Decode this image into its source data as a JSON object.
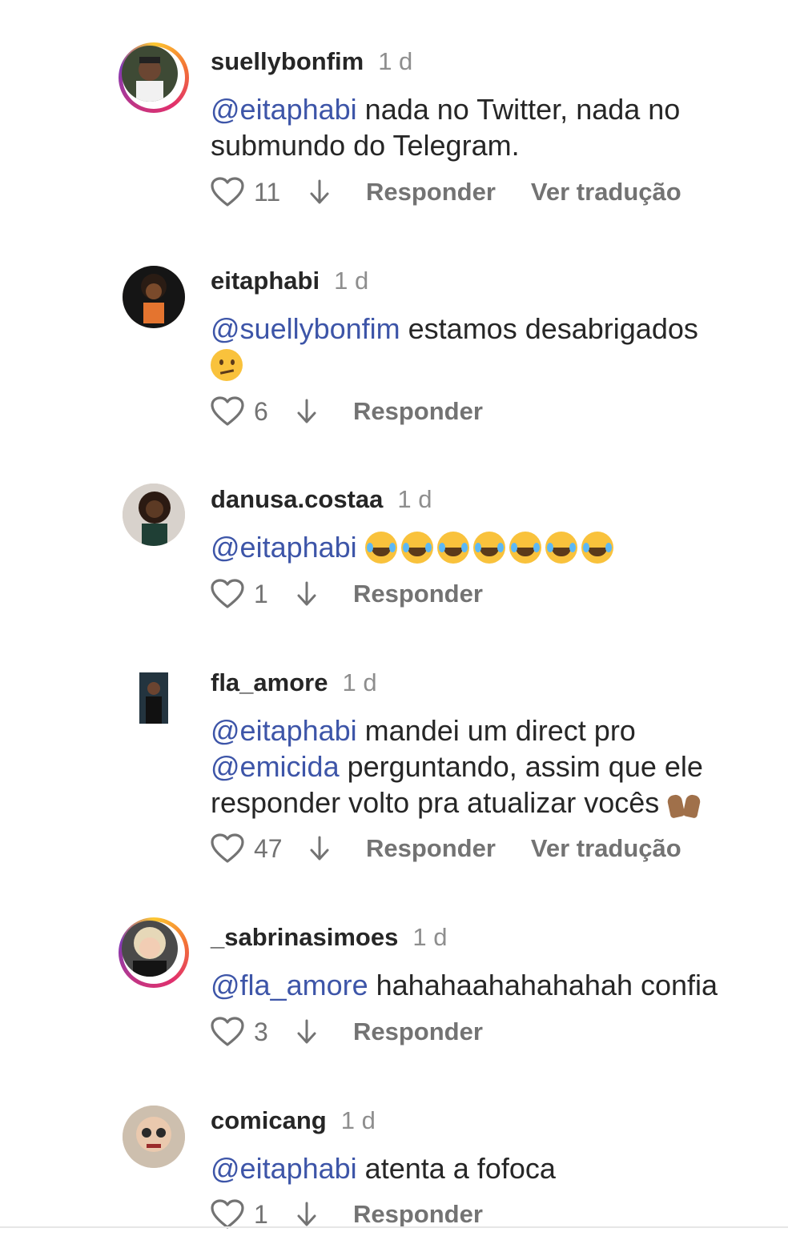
{
  "labels": {
    "reply": "Responder",
    "translate": "Ver tradução"
  },
  "icons": {
    "like": "heart-icon",
    "more": "arrow-down-icon"
  },
  "colors": {
    "mention": "#3d55a8",
    "muted": "#737373",
    "text": "#262626"
  },
  "comments": [
    {
      "username": "suellybonfim",
      "time": "1 d",
      "mention": "@eitaphabi",
      "text": " nada no Twitter, nada no submundo do Telegram.",
      "likes": "11",
      "has_translate": true
    },
    {
      "username": "eitaphabi",
      "time": "1 d",
      "mention": "@suellybonfim",
      "text": " estamos desabrigados",
      "emoji": "confused-face",
      "likes": "6",
      "has_translate": false
    },
    {
      "username": "danusa.costaa",
      "time": "1 d",
      "mention": "@eitaphabi",
      "text": "",
      "emoji": "tears-of-joy x7",
      "likes": "1",
      "has_translate": false
    },
    {
      "username": "fla_amore",
      "time": "1 d",
      "mention": "@eitaphabi",
      "text": " mandei um direct pro ",
      "mention2": "@emicida",
      "text2": " perguntando, assim que ele responder volto pra atualizar vocês",
      "emoji": "raising-hands",
      "likes": "47",
      "has_translate": true
    },
    {
      "username": "_sabrinasimoes",
      "time": "1 d",
      "mention": "@fla_amore",
      "text": " hahahaahahahahah confia",
      "likes": "3",
      "has_translate": false
    },
    {
      "username": "comicang",
      "time": "1 d",
      "mention": "@eitaphabi",
      "text": " atenta a fofoca",
      "likes": "1",
      "has_translate": false
    }
  ]
}
